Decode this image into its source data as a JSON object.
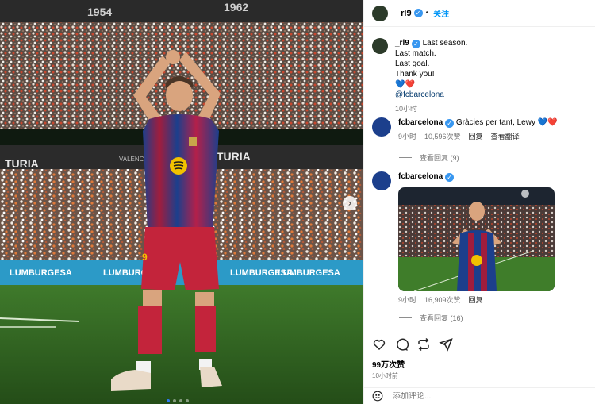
{
  "photo": {
    "stand_numbers": [
      "1954",
      "1962"
    ],
    "board_text": [
      "TURIA",
      "TURIA"
    ],
    "banner_text": [
      "VALENCIA"
    ],
    "pitch_ads": [
      "LUMBURGESA",
      "LUMBURGESA",
      "LUMBURGESA",
      "LUMBURGESA"
    ],
    "shorts_number": "9",
    "carousel_dots": 4,
    "active_dot": 0,
    "next_arrow": "›"
  },
  "post": {
    "author": "_rl9",
    "follow_label": "关注",
    "separator": "•",
    "caption_lines": [
      "Last season.",
      "Last match.",
      "Last goal.",
      "Thank you!"
    ],
    "caption_hearts": "💙❤️",
    "caption_mention": "@fcbarcelona",
    "caption_time": "10小时",
    "likes": "99万次赞",
    "posted_ago": "10小时前"
  },
  "comments": [
    {
      "user": "fcbarcelona",
      "text": "Gràcies per tant, Lewy",
      "hearts": "💙❤️",
      "time": "9小时",
      "likes": "10,596次赞",
      "reply_label": "回复",
      "translate_label": "查看翻译",
      "view_replies": "查看回复 (9)"
    },
    {
      "user": "fcbarcelona",
      "time": "9小时",
      "likes": "16,909次赞",
      "reply_label": "回复",
      "view_replies": "查看回复 (16)"
    }
  ],
  "add_comment": {
    "placeholder": "添加评论..."
  },
  "colors": {
    "verified_blue": "#3897f0",
    "follow_blue": "#0095f6",
    "mention": "#00376b",
    "muted": "#737373",
    "barca_blue": "#1c3f8c",
    "barca_red": "#a01d3d"
  },
  "icons": [
    "verified-badge-icon",
    "heart-icon",
    "comment-icon",
    "repost-icon",
    "share-icon",
    "emoji-icon",
    "chevron-right-icon"
  ]
}
